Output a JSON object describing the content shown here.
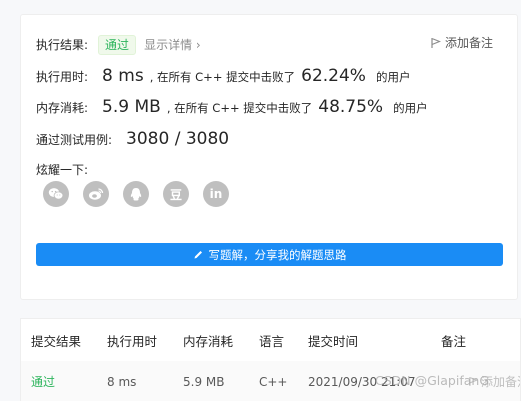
{
  "result": {
    "label": "执行结果:",
    "status": "通过",
    "detail_link": "显示详情",
    "detail_chevron": "›",
    "add_note": "添加备注",
    "runtime_label": "执行用时:",
    "runtime_value": "8 ms",
    "runtime_text": ", 在所有 C++ 提交中击败了",
    "runtime_pct": "62.24%",
    "runtime_suffix": "的用户",
    "memory_label": "内存消耗:",
    "memory_value": "5.9 MB",
    "memory_text": ", 在所有 C++ 提交中击败了",
    "memory_pct": "48.75%",
    "memory_suffix": "的用户",
    "tests_label": "通过测试用例:",
    "tests_value": "3080 / 3080",
    "share_label": "炫耀一下:",
    "share_icons": [
      "wechat-icon",
      "weibo-icon",
      "qq-icon",
      "douban-icon",
      "linkedin-icon"
    ],
    "douban_glyph": "豆",
    "linkedin_glyph": "in",
    "write_button": "写题解，分享我的解题思路"
  },
  "table": {
    "headers": [
      "提交结果",
      "执行用时",
      "内存消耗",
      "语言",
      "提交时间",
      "备注"
    ],
    "rows": [
      {
        "result": "通过",
        "runtime": "8 ms",
        "memory": "5.9 MB",
        "language": "C++",
        "time": "2021/09/30 21:07",
        "note": "添加备注"
      }
    ]
  },
  "watermark": "CSDN @GlapifanG",
  "colors": {
    "accent": "#1a8cf5",
    "success": "#2db55d",
    "icon_gray": "#bfbfbf"
  }
}
